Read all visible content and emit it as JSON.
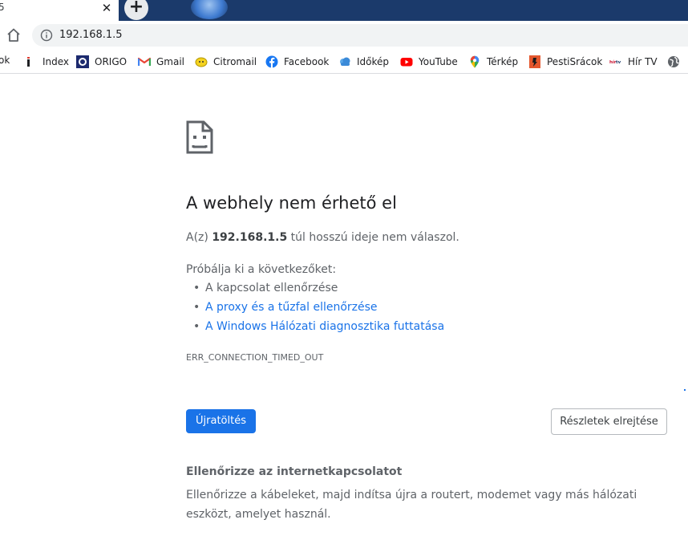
{
  "tab": {
    "title": "5",
    "close_glyph": "✕",
    "new_tab_glyph": "+"
  },
  "toolbar": {
    "home_icon": "home-icon",
    "info_icon": "info-icon",
    "url": "192.168.1.5"
  },
  "bookmarks": {
    "cut_label": "ok",
    "items": [
      {
        "label": "Index",
        "icon": "index-icon"
      },
      {
        "label": "ORIGO",
        "icon": "origo-icon"
      },
      {
        "label": "Gmail",
        "icon": "gmail-icon"
      },
      {
        "label": "Citromail",
        "icon": "citromail-icon"
      },
      {
        "label": "Facebook",
        "icon": "facebook-icon"
      },
      {
        "label": "Időkép",
        "icon": "idokep-icon"
      },
      {
        "label": "YouTube",
        "icon": "youtube-icon"
      },
      {
        "label": "Térkép",
        "icon": "maps-icon"
      },
      {
        "label": "PestiSrácok",
        "icon": "pestisracok-icon"
      },
      {
        "label": "Hír TV",
        "icon": "hirtv-icon"
      },
      {
        "label": "",
        "icon": "globe-icon"
      }
    ]
  },
  "error": {
    "icon": "sad-page-icon",
    "heading": "A webhely nem érhető el",
    "subtitle_prefix": "A(z) ",
    "subtitle_host": "192.168.1.5",
    "subtitle_suffix": " túl hosszú ideje nem válaszol.",
    "try_label": "Próbálja ki a következőket:",
    "suggestions": [
      {
        "text": "A kapcsolat ellenőrzése",
        "link": false
      },
      {
        "text": "A proxy és a tűzfal ellenőrzése",
        "link": true
      },
      {
        "text": "A Windows Hálózati diagnosztika futtatása",
        "link": true
      }
    ],
    "code": "ERR_CONNECTION_TIMED_OUT",
    "reload_label": "Újratöltés",
    "details_label": "Részletek elrejtése",
    "details_heading": "Ellenőrizze az internetkapcsolatot",
    "details_text": "Ellenőrizze a kábeleket, majd indítsa újra a routert, modemet vagy más hálózati eszközt, amelyet használ."
  },
  "colors": {
    "accent": "#1a73e8",
    "tabstrip": "#1b3a6b",
    "text_secondary": "#5f6368"
  }
}
